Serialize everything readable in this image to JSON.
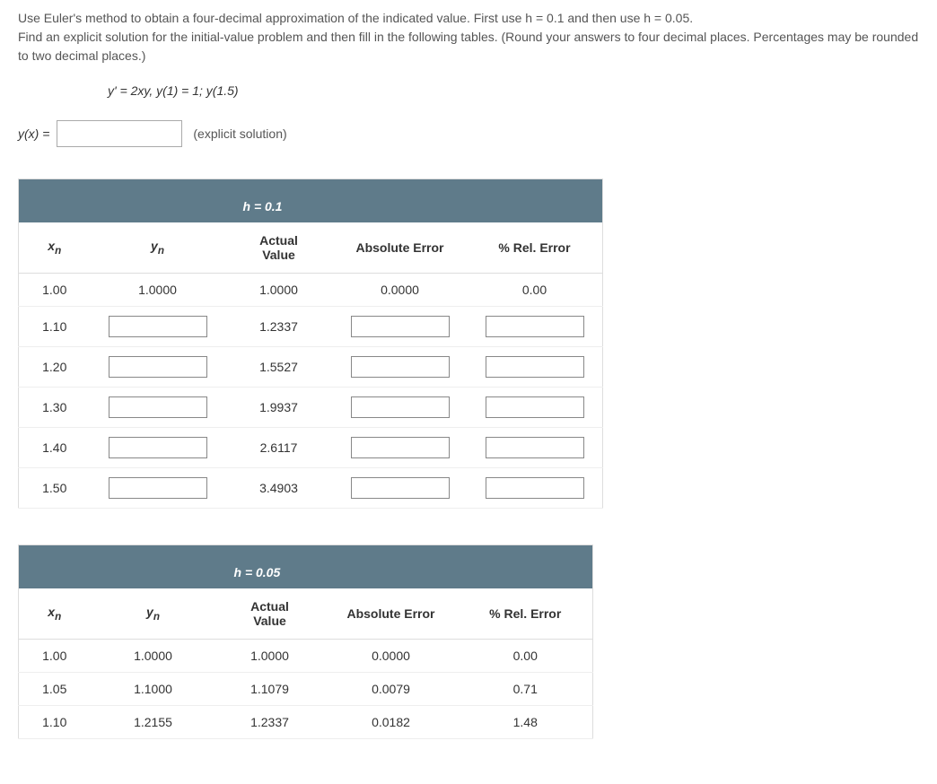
{
  "instructions": {
    "line1": "Use Euler's method to obtain a four-decimal approximation of the indicated value. First use h = 0.1 and then use h = 0.05.",
    "line2": "Find an explicit solution for the initial-value problem and then fill in the following tables. (Round your answers to four decimal places. Percentages may be rounded to two decimal places.)"
  },
  "equation": "y' = 2xy,   y(1) = 1; y(1.5)",
  "explicit": {
    "prefix": "y(x) =",
    "hint": "(explicit solution)",
    "value": ""
  },
  "headers": {
    "xn_main": "x",
    "xn_sub": "n",
    "yn_main": "y",
    "yn_sub": "n",
    "actual": "Actual Value",
    "abs": "Absolute Error",
    "rel": "% Rel. Error"
  },
  "table1": {
    "banner": "h = 0.1",
    "rows": [
      {
        "xn": "1.00",
        "yn": "1.0000",
        "yn_input": false,
        "actual": "1.0000",
        "abs": "0.0000",
        "abs_input": false,
        "rel": "0.00",
        "rel_input": false
      },
      {
        "xn": "1.10",
        "yn": "",
        "yn_input": true,
        "actual": "1.2337",
        "abs": "",
        "abs_input": true,
        "rel": "",
        "rel_input": true
      },
      {
        "xn": "1.20",
        "yn": "",
        "yn_input": true,
        "actual": "1.5527",
        "abs": "",
        "abs_input": true,
        "rel": "",
        "rel_input": true
      },
      {
        "xn": "1.30",
        "yn": "",
        "yn_input": true,
        "actual": "1.9937",
        "abs": "",
        "abs_input": true,
        "rel": "",
        "rel_input": true
      },
      {
        "xn": "1.40",
        "yn": "",
        "yn_input": true,
        "actual": "2.6117",
        "abs": "",
        "abs_input": true,
        "rel": "",
        "rel_input": true
      },
      {
        "xn": "1.50",
        "yn": "",
        "yn_input": true,
        "actual": "3.4903",
        "abs": "",
        "abs_input": true,
        "rel": "",
        "rel_input": true
      }
    ]
  },
  "table2": {
    "banner": "h = 0.05",
    "rows": [
      {
        "xn": "1.00",
        "yn": "1.0000",
        "yn_input": false,
        "actual": "1.0000",
        "abs": "0.0000",
        "abs_input": false,
        "rel": "0.00",
        "rel_input": false
      },
      {
        "xn": "1.05",
        "yn": "1.1000",
        "yn_input": false,
        "actual": "1.1079",
        "abs": "0.0079",
        "abs_input": false,
        "rel": "0.71",
        "rel_input": false
      },
      {
        "xn": "1.10",
        "yn": "1.2155",
        "yn_input": false,
        "actual": "1.2337",
        "abs": "0.0182",
        "abs_input": false,
        "rel": "1.48",
        "rel_input": false
      }
    ]
  }
}
